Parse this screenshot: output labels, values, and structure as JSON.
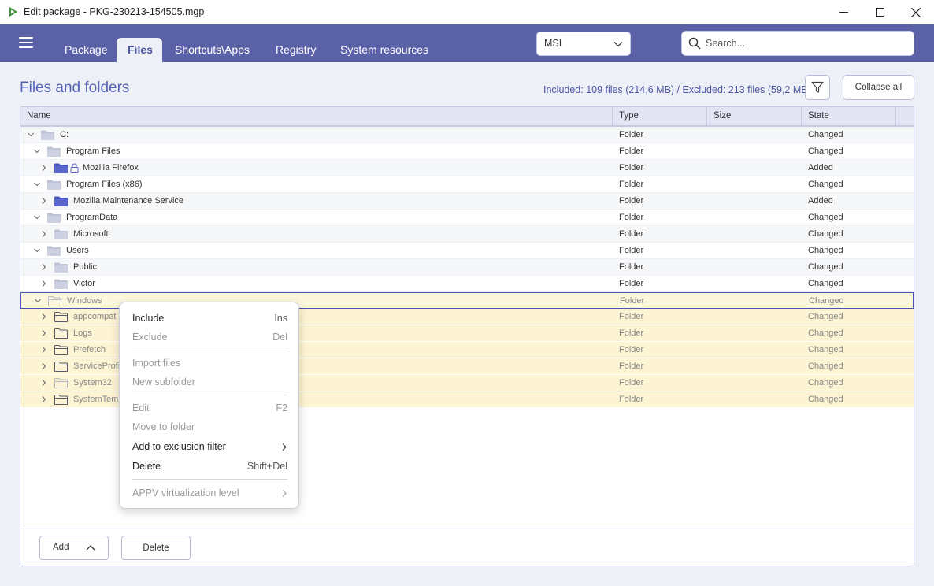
{
  "window": {
    "title": "Edit package - PKG-230213-154505.mgp"
  },
  "nav": {
    "tabs": [
      {
        "label": "Package"
      },
      {
        "label": "Files"
      },
      {
        "label": "Shortcuts\\Apps"
      },
      {
        "label": "Registry"
      },
      {
        "label": "System resources"
      }
    ],
    "active_tab": "Files",
    "package_type": "MSI",
    "search_placeholder": "Search..."
  },
  "header": {
    "title": "Files and folders",
    "stats": "Included: 109 files (214,6 MB) / Excluded: 213 files (59,2 MB)",
    "collapse_label": "Collapse all"
  },
  "table": {
    "columns": [
      "Name",
      "Type",
      "Size",
      "State"
    ],
    "rows": [
      {
        "name": "C:",
        "type": "Folder",
        "size": "",
        "state": "Changed"
      },
      {
        "name": "Program Files",
        "type": "Folder",
        "size": "",
        "state": "Changed"
      },
      {
        "name": "Mozilla Firefox",
        "type": "Folder",
        "size": "",
        "state": "Added"
      },
      {
        "name": "Program Files (x86)",
        "type": "Folder",
        "size": "",
        "state": "Changed"
      },
      {
        "name": "Mozilla Maintenance Service",
        "type": "Folder",
        "size": "",
        "state": "Added"
      },
      {
        "name": "ProgramData",
        "type": "Folder",
        "size": "",
        "state": "Changed"
      },
      {
        "name": "Microsoft",
        "type": "Folder",
        "size": "",
        "state": "Changed"
      },
      {
        "name": "Users",
        "type": "Folder",
        "size": "",
        "state": "Changed"
      },
      {
        "name": "Public",
        "type": "Folder",
        "size": "",
        "state": "Changed"
      },
      {
        "name": "Victor",
        "type": "Folder",
        "size": "",
        "state": "Changed"
      },
      {
        "name": "Windows",
        "type": "Folder",
        "size": "",
        "state": "Changed"
      },
      {
        "name": "appcompat",
        "type": "Folder",
        "size": "",
        "state": "Changed"
      },
      {
        "name": "Logs",
        "type": "Folder",
        "size": "",
        "state": "Changed"
      },
      {
        "name": "Prefetch",
        "type": "Folder",
        "size": "",
        "state": "Changed"
      },
      {
        "name": "ServiceProfi",
        "type": "Folder",
        "size": "",
        "state": "Changed"
      },
      {
        "name": "System32",
        "type": "Folder",
        "size": "",
        "state": "Changed"
      },
      {
        "name": "SystemTemp",
        "type": "Folder",
        "size": "",
        "state": "Changed"
      }
    ]
  },
  "footer": {
    "add_label": "Add",
    "delete_label": "Delete"
  },
  "context_menu": {
    "items": [
      {
        "label": "Include",
        "shortcut": "Ins",
        "enabled": true
      },
      {
        "label": "Exclude",
        "shortcut": "Del",
        "enabled": false
      },
      {
        "label": "Import files",
        "shortcut": "",
        "enabled": false
      },
      {
        "label": "New subfolder",
        "shortcut": "",
        "enabled": false
      },
      {
        "label": "Edit",
        "shortcut": "F2",
        "enabled": false
      },
      {
        "label": "Move to folder",
        "shortcut": "",
        "enabled": false
      },
      {
        "label": "Add to exclusion filter",
        "shortcut": "",
        "enabled": true
      },
      {
        "label": "Delete",
        "shortcut": "Shift+Del",
        "enabled": true
      },
      {
        "label": "APPV virtualization level",
        "shortcut": "",
        "enabled": false
      }
    ]
  },
  "colors": {
    "nav_bg": "#5b61a6",
    "accent": "#5662b6",
    "selection_bg": "#fdf4d3",
    "folder_blue": "#4b57c0",
    "folder_gray": "#c8ccdc"
  }
}
